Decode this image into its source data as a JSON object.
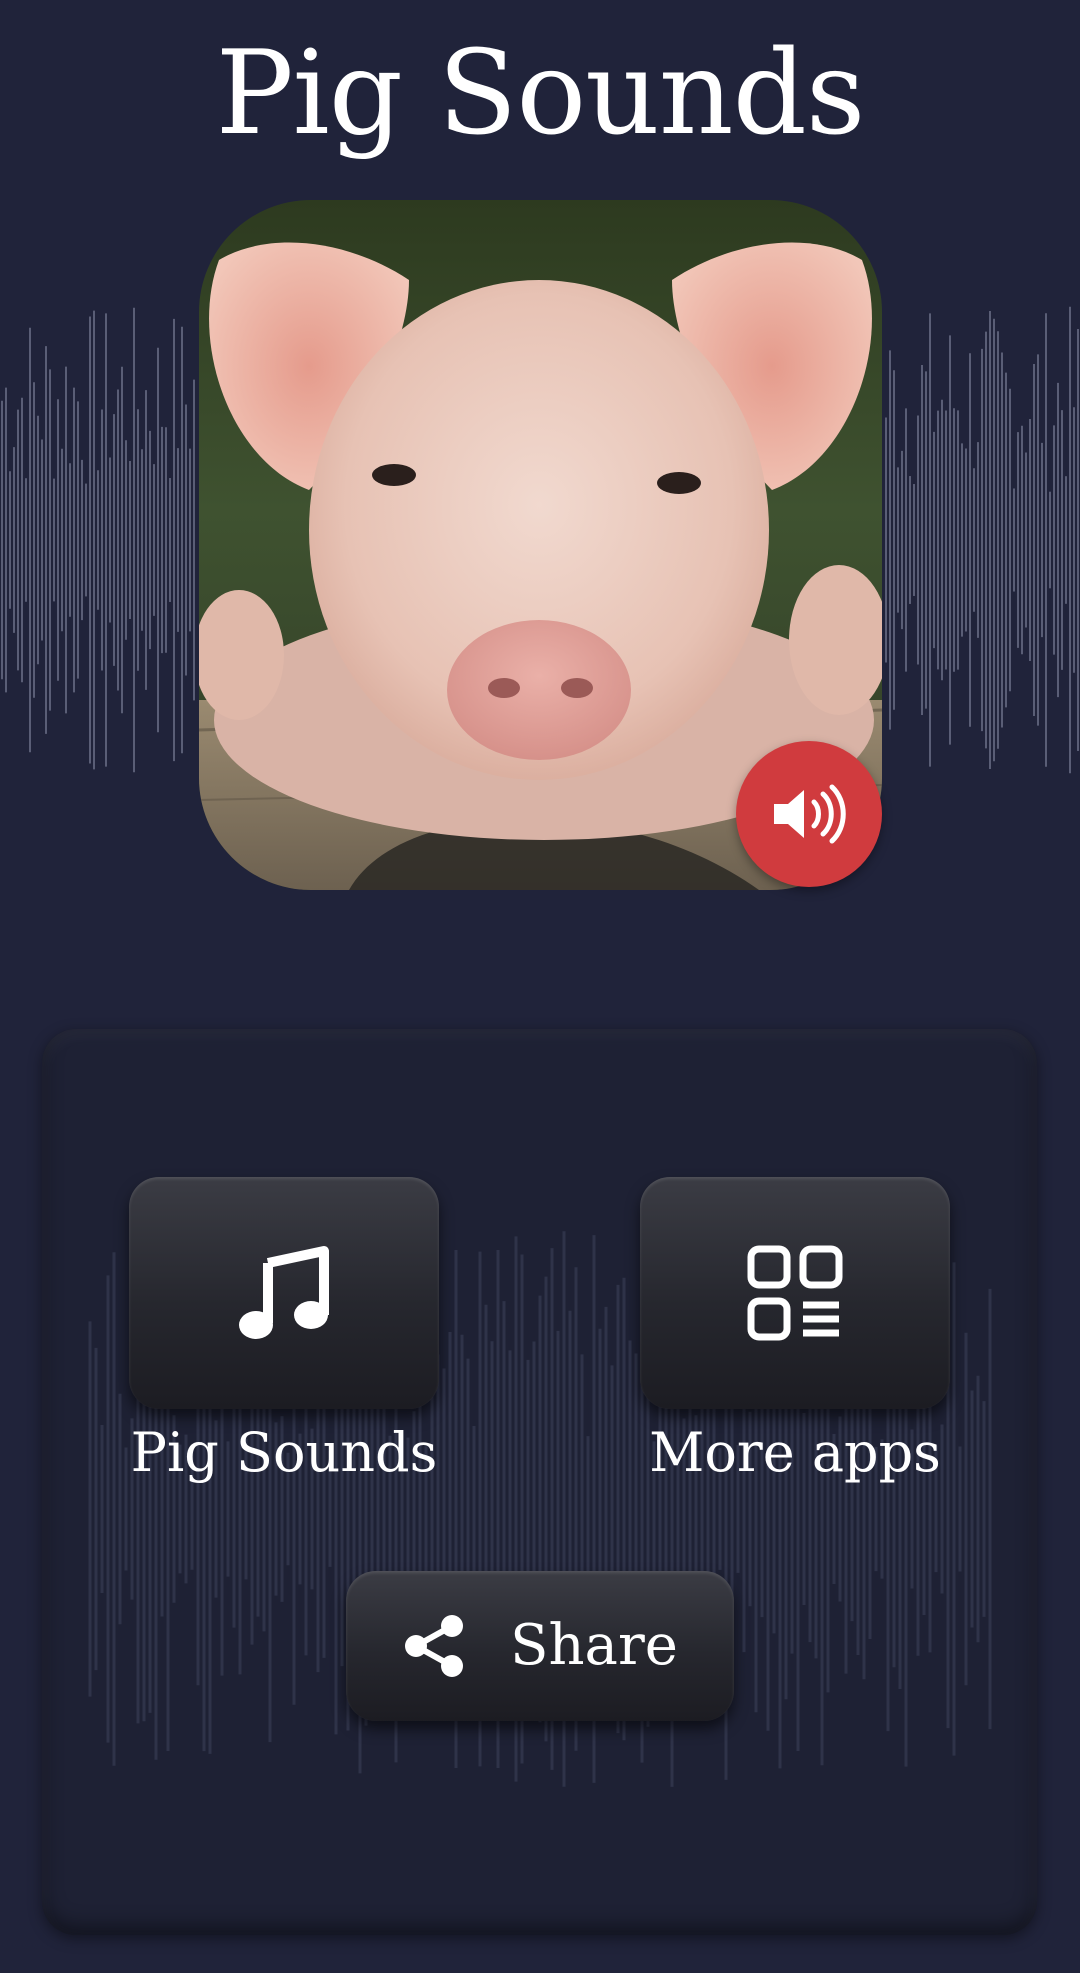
{
  "app": {
    "title": "Pig Sounds"
  },
  "hero": {
    "image": "pig-photo",
    "badge_icon": "speaker-volume-icon",
    "badge_color": "#d03b3e"
  },
  "menu": {
    "sounds_button": {
      "label": "Pig Sounds",
      "icon": "music-note-icon"
    },
    "more_apps_button": {
      "label": "More apps",
      "icon": "apps-grid-icon"
    },
    "share_button": {
      "label": "Share",
      "icon": "share-icon"
    }
  },
  "colors": {
    "background": "#20233a",
    "panel": "#1e2134",
    "tile": "#2a2b32",
    "text": "#ffffff"
  }
}
